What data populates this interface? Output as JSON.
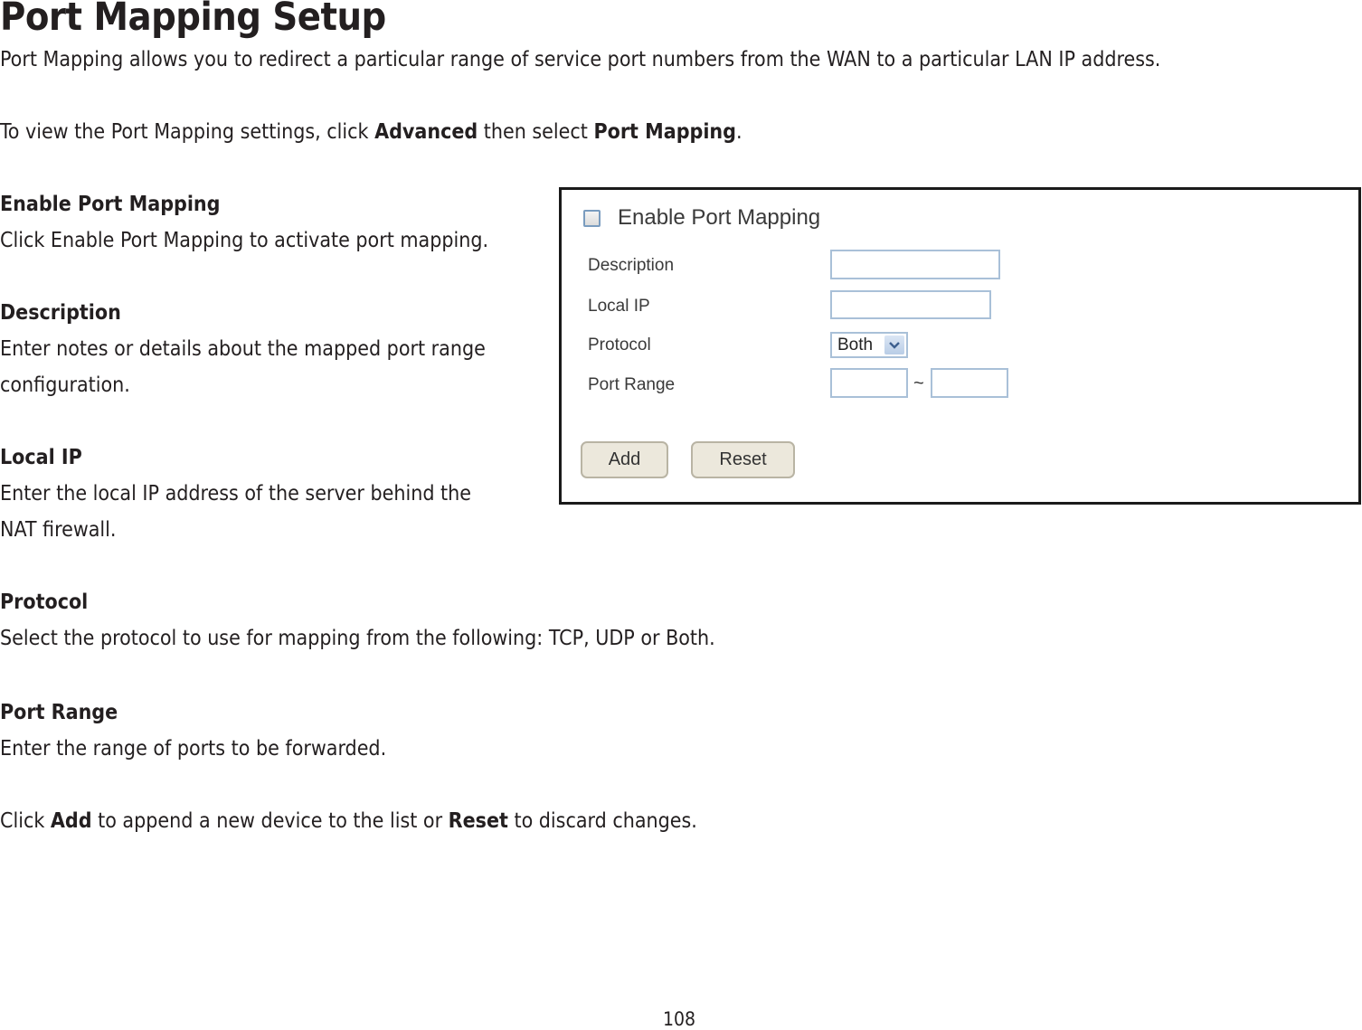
{
  "title": "Port Mapping Setup",
  "intro": "Port Mapping allows you to redirect a particular range of service port numbers from the WAN to a particular LAN IP address.",
  "navigation": {
    "prefix": "To view the Port Mapping settings, click ",
    "bold1": "Advanced",
    "middle": " then select ",
    "bold2": "Port Mapping",
    "suffix": "."
  },
  "sections": [
    {
      "heading": "Enable Port Mapping",
      "lines": [
        "Click Enable Port Mapping to activate port mapping."
      ]
    },
    {
      "heading": "Description",
      "lines": [
        "Enter notes or details about the mapped port range",
        "configuration."
      ]
    },
    {
      "heading": "Local IP",
      "lines": [
        "Enter the local IP address of the server behind the",
        "NAT firewall."
      ]
    },
    {
      "heading": "Protocol",
      "lines": [
        "Select the protocol to use for mapping from the following: TCP, UDP or Both."
      ]
    },
    {
      "heading": "Port Range",
      "lines": [
        "Enter the range of ports to be forwarded."
      ]
    }
  ],
  "closing": {
    "prefix": "Click ",
    "bold1": "Add",
    "middle": " to append a new device to the list or ",
    "bold2": "Reset",
    "suffix": " to discard changes."
  },
  "screenshot": {
    "enable_label": "Enable Port Mapping",
    "enable_checked": false,
    "fields": {
      "description_label": "Description",
      "description_value": "",
      "local_ip_label": "Local IP",
      "local_ip_value": "",
      "protocol_label": "Protocol",
      "protocol_value": "Both",
      "port_range_label": "Port Range",
      "port_start_value": "",
      "port_end_value": "",
      "range_separator": "~"
    },
    "buttons": {
      "add": "Add",
      "reset": "Reset"
    }
  },
  "page_number": "108"
}
